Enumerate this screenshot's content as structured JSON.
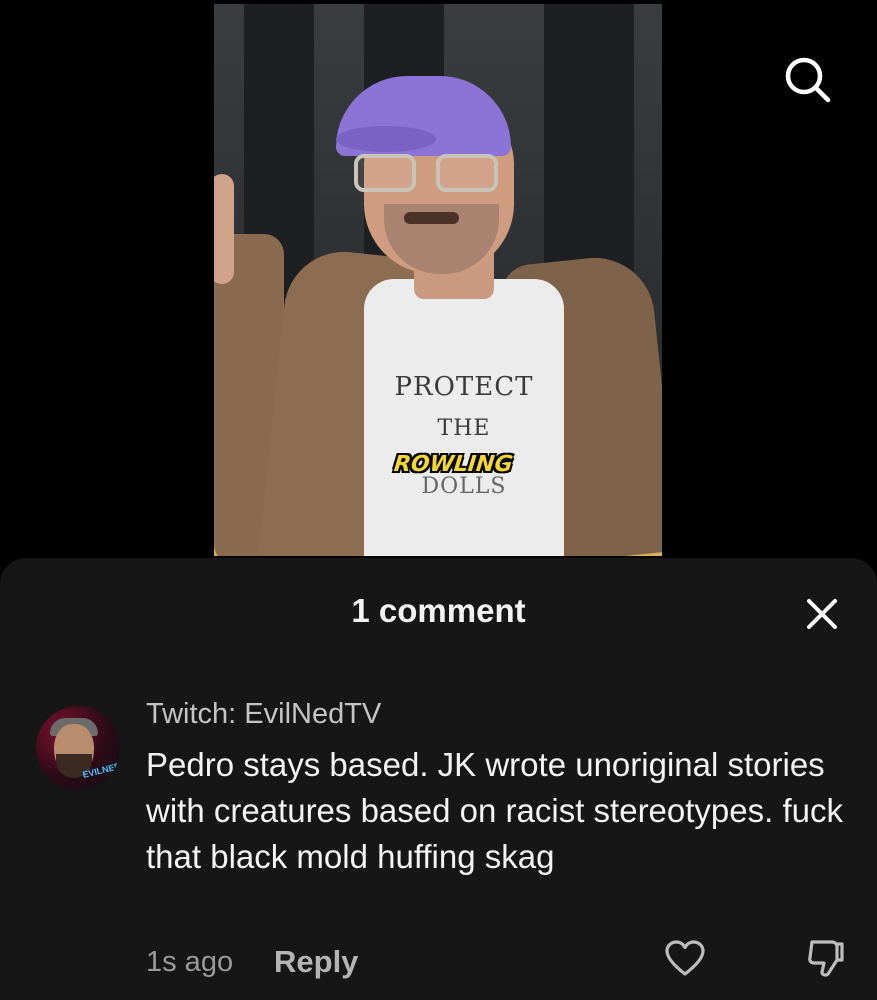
{
  "video": {
    "shirt_line1": "PROTECT",
    "shirt_line2": "THE",
    "shirt_line3": "DOLLS",
    "caption": "ROWLING",
    "caption_color": "#f7d532",
    "search_icon": "search-icon"
  },
  "comments_sheet": {
    "title": "1 comment",
    "close_icon": "close-icon",
    "background": "#161616",
    "comments": [
      {
        "username": "Twitch: EvilNedTV",
        "text": "Pedro stays based. JK wrote unoriginal stories with creatures based on racist stereotypes. fuck that black mold huffing skag",
        "timestamp": "1s ago",
        "reply_label": "Reply",
        "avatar_text": "EVILNEDTV",
        "like_icon": "heart-icon",
        "dislike_icon": "thumbs-down-icon"
      }
    ]
  }
}
